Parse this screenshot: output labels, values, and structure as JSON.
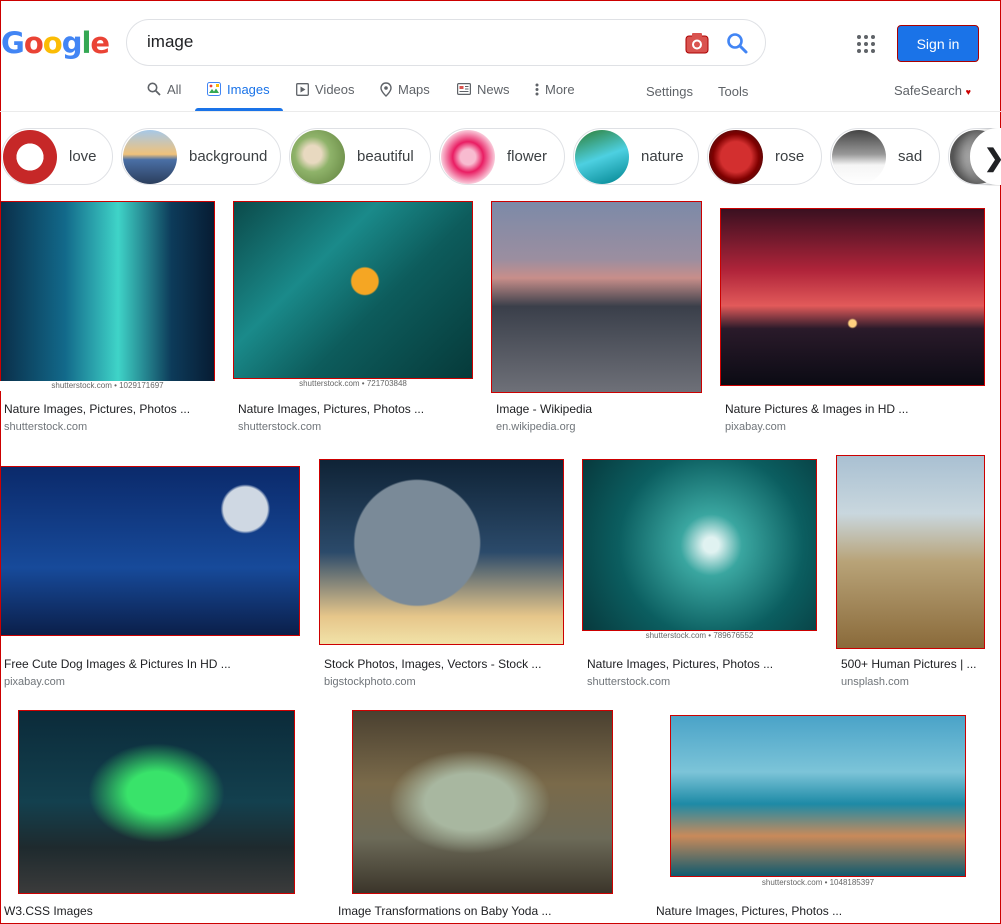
{
  "header": {
    "logo_letters": [
      {
        "ch": "G",
        "color": "#4285f4"
      },
      {
        "ch": "o",
        "color": "#ea4335"
      },
      {
        "ch": "o",
        "color": "#fbbc05"
      },
      {
        "ch": "g",
        "color": "#4285f4"
      },
      {
        "ch": "l",
        "color": "#34a853"
      },
      {
        "ch": "e",
        "color": "#ea4335"
      }
    ],
    "search_query": "image",
    "signin_label": "Sign in"
  },
  "tabs": {
    "all": "All",
    "images": "Images",
    "videos": "Videos",
    "maps": "Maps",
    "news": "News",
    "more": "More",
    "settings": "Settings",
    "tools": "Tools",
    "safesearch": "SafeSearch"
  },
  "chips": [
    {
      "label": "love",
      "icon": "couple-thumb"
    },
    {
      "label": "background",
      "icon": "lake-thumb"
    },
    {
      "label": "beautiful",
      "icon": "girl-thumb"
    },
    {
      "label": "flower",
      "icon": "flower-thumb"
    },
    {
      "label": "nature",
      "icon": "waterfall-thumb"
    },
    {
      "label": "rose",
      "icon": "rose-thumb"
    },
    {
      "label": "sad",
      "icon": "eye-thumb"
    }
  ],
  "results": [
    {
      "title": "Nature Images, Pictures, Photos ...",
      "domain": "shutterstock.com",
      "watermark": "shutterstock.com • 1029171697"
    },
    {
      "title": "Nature Images, Pictures, Photos ...",
      "domain": "shutterstock.com",
      "watermark": "shutterstock.com • 721703848"
    },
    {
      "title": "Image - Wikipedia",
      "domain": "en.wikipedia.org",
      "watermark": ""
    },
    {
      "title": "Nature Pictures & Images in HD ...",
      "domain": "pixabay.com",
      "watermark": ""
    },
    {
      "title": "Free Cute Dog Images & Pictures In HD ...",
      "domain": "pixabay.com",
      "watermark": ""
    },
    {
      "title": "Stock Photos, Images, Vectors - Stock ...",
      "domain": "bigstockphoto.com",
      "watermark": ""
    },
    {
      "title": "Nature Images, Pictures, Photos ...",
      "domain": "shutterstock.com",
      "watermark": "shutterstock.com • 789676552"
    },
    {
      "title": "500+ Human Pictures | ...",
      "domain": "unsplash.com",
      "watermark": ""
    },
    {
      "title": "W3.CSS Images",
      "domain": "",
      "watermark": ""
    },
    {
      "title": "Image Transformations on Baby Yoda ...",
      "domain": "",
      "watermark": ""
    },
    {
      "title": "Nature Images, Pictures, Photos ...",
      "domain": "",
      "watermark": "shutterstock.com • 1048185397"
    }
  ]
}
